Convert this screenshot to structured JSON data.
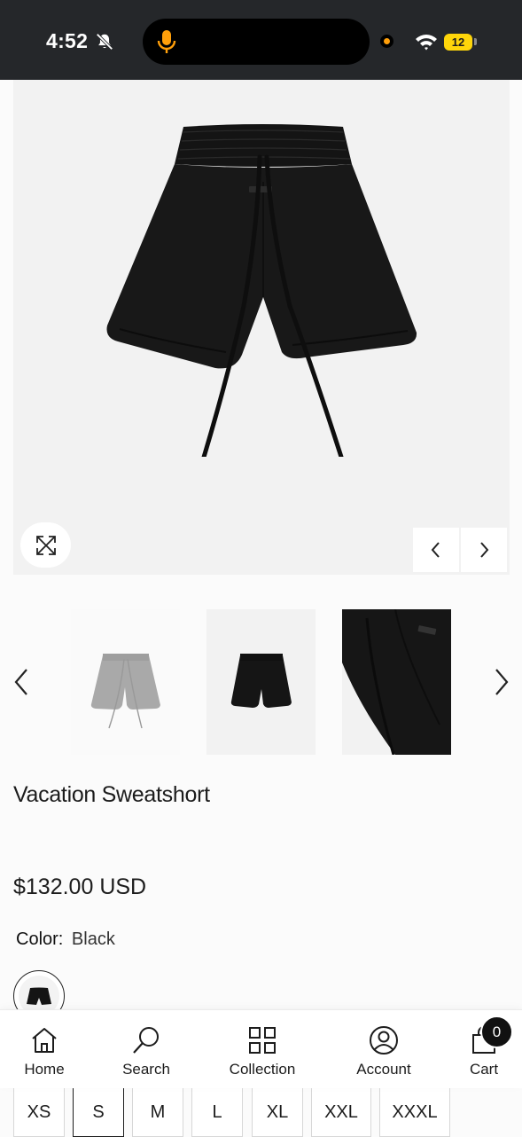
{
  "status_bar": {
    "time": "4:52",
    "battery": "12"
  },
  "product": {
    "title": "Vacation Sweatshort",
    "price": "$132.00 USD",
    "color_label": "Color:",
    "color_value": "Black"
  },
  "sizes": [
    "XS",
    "S",
    "M",
    "L",
    "XL",
    "XXL",
    "XXXL"
  ],
  "selected_size": "S",
  "bottom_nav": {
    "home": "Home",
    "search": "Search",
    "collection": "Collection",
    "account": "Account",
    "cart": "Cart",
    "cart_count": "0"
  },
  "icons": {
    "status": [
      "bell-slash-icon",
      "mic-icon",
      "wifi-icon",
      "battery-icon"
    ],
    "gallery": [
      "expand-icon",
      "chevron-left-icon",
      "chevron-right-icon"
    ],
    "nav": [
      "home-icon",
      "search-icon",
      "grid-icon",
      "user-circle-icon",
      "bag-icon"
    ]
  },
  "colors": {
    "status_bar_bg": "#25272a",
    "mic_orange": "#ff9f0a",
    "battery_yellow": "#ffd60a",
    "product_black": "#161616"
  }
}
